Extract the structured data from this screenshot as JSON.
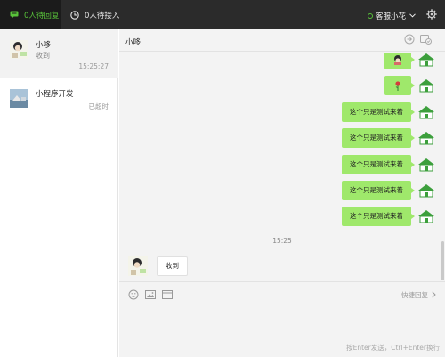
{
  "topbar": {
    "tab_pending_reply": "0人待回复",
    "tab_pending_accept": "0人待接入",
    "agent_name": "客服小花"
  },
  "sessions": [
    {
      "name": "小哆",
      "last_message": "收到",
      "time": "15:25:27"
    },
    {
      "name": "小程序开发",
      "status": "已超时"
    }
  ],
  "chat": {
    "title": "小哆",
    "outgoing_text": "这个只是测试来着",
    "outgoing_count": 5,
    "time_separator": "15:25",
    "incoming_text": "收到"
  },
  "composer": {
    "quick_reply": "快捷回复",
    "hint": "按Enter发送，Ctrl+Enter换行"
  },
  "colors": {
    "accent": "#58c33a",
    "bubble_out": "#9fe86b",
    "topbar": "#2b2b2b"
  },
  "icons": [
    "chat-bubble-icon",
    "clock-icon",
    "status-dot-icon",
    "chevron-down-icon",
    "gear-icon",
    "transfer-icon",
    "end-session-icon",
    "emoji-icon",
    "image-icon",
    "quick-text-icon",
    "chevron-right-icon"
  ]
}
